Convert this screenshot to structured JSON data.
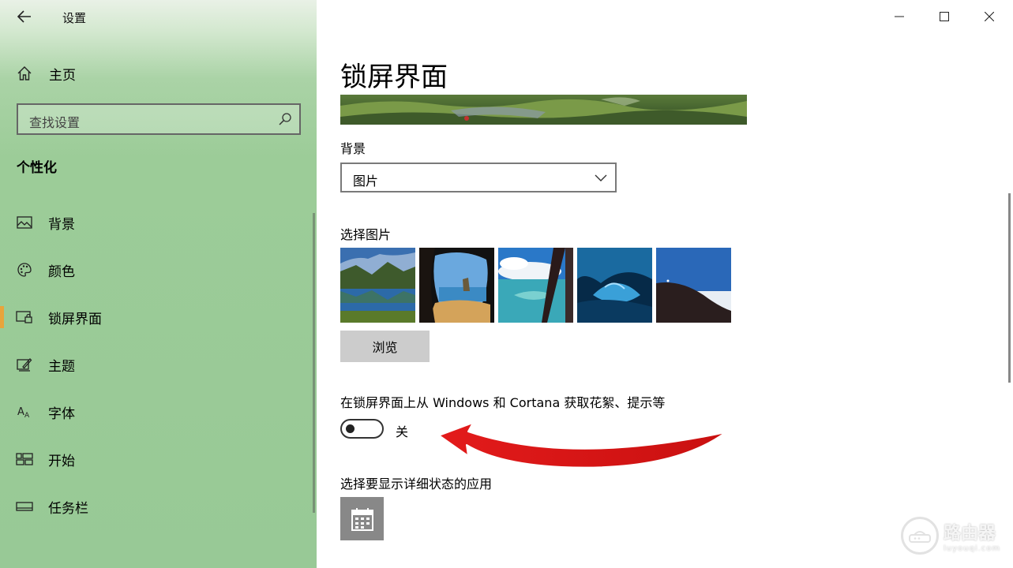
{
  "window": {
    "title": "设置",
    "controls": [
      "minimize",
      "maximize",
      "close"
    ]
  },
  "sidebar": {
    "home_label": "主页",
    "search_placeholder": "查找设置",
    "section_title": "个性化",
    "items": [
      {
        "label": "背景",
        "icon": "picture-icon"
      },
      {
        "label": "颜色",
        "icon": "palette-icon"
      },
      {
        "label": "锁屏界面",
        "icon": "lock-screen-icon",
        "active": true
      },
      {
        "label": "主题",
        "icon": "theme-brush-icon"
      },
      {
        "label": "字体",
        "icon": "font-icon"
      },
      {
        "label": "开始",
        "icon": "start-tiles-icon"
      },
      {
        "label": "任务栏",
        "icon": "taskbar-icon"
      }
    ],
    "active_color": "#e8a43b"
  },
  "main": {
    "page_title": "锁屏界面",
    "background_label": "背景",
    "background_value": "图片",
    "choose_picture_label": "选择图片",
    "browse_label": "浏览",
    "spotlight_label": "在锁屏界面上从 Windows 和 Cortana 获取花絮、提示等",
    "spotlight_toggle_on": false,
    "spotlight_state": "关",
    "detailed_status_label": "选择要显示详细状态的应用",
    "detailed_status_app_icon": "calendar-icon"
  },
  "watermark": {
    "title": "路由器",
    "subtitle": "luyouqi.com"
  },
  "annotation": {
    "arrow_color": "#e31b1b"
  }
}
